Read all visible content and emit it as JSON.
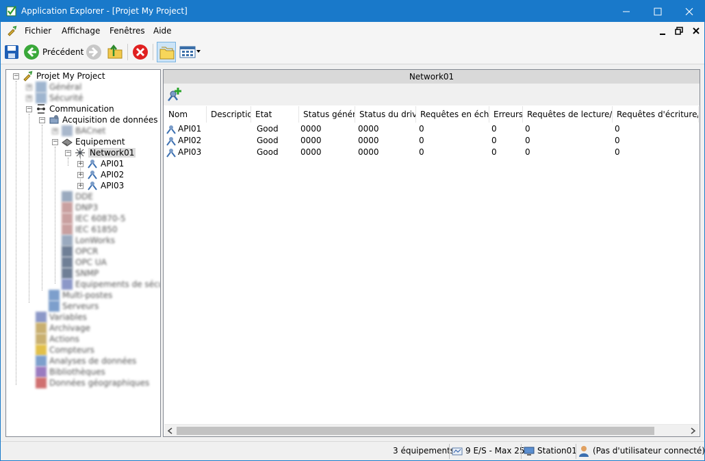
{
  "window": {
    "title": "Application Explorer - [Projet My Project]",
    "accent": "#1979ca"
  },
  "menu": {
    "items": [
      "Fichier",
      "Affichage",
      "Fenêtres",
      "Aide"
    ]
  },
  "toolbar": {
    "back_label": "Précédent"
  },
  "tree": {
    "root": "Projet My Project",
    "communication": "Communication",
    "acquisition": "Acquisition de données",
    "equipement": "Equipement",
    "network": "Network01",
    "apis": [
      "API01",
      "API02",
      "API03"
    ],
    "blurred": [
      "Général",
      "Sécurité",
      "BACnet",
      "DDE",
      "DNP3",
      "IEC 60870-5",
      "IEC 61850",
      "LonWorks",
      "OPCR",
      "OPC UA",
      "SNMP",
      "Equipements de sécurité",
      "Multi-postes",
      "Serveurs",
      "Variables",
      "Archivage",
      "Actions",
      "Compteurs",
      "Analyses de données",
      "Bibliothèques",
      "Données géographiques"
    ]
  },
  "panel": {
    "title": "Network01",
    "columns": [
      "Nom",
      "Description",
      "Etat",
      "Status général",
      "Status du driver",
      "Requêtes en échec",
      "Erreurs",
      "Requêtes de lecture/sec",
      "Requêtes d'écriture/sec"
    ],
    "rows": [
      [
        "API01",
        "",
        "Good",
        "0000",
        "0000",
        "0",
        "0",
        "0",
        "0"
      ],
      [
        "API02",
        "",
        "Good",
        "0000",
        "0000",
        "0",
        "0",
        "0",
        "0"
      ],
      [
        "API03",
        "",
        "Good",
        "0000",
        "0000",
        "0",
        "0",
        "0",
        "0"
      ]
    ]
  },
  "status": {
    "equipements": "3 équipements",
    "io": "9 E/S - Max 25",
    "station": "Station01",
    "user": "(Pas d'utilisateur connecté)"
  }
}
